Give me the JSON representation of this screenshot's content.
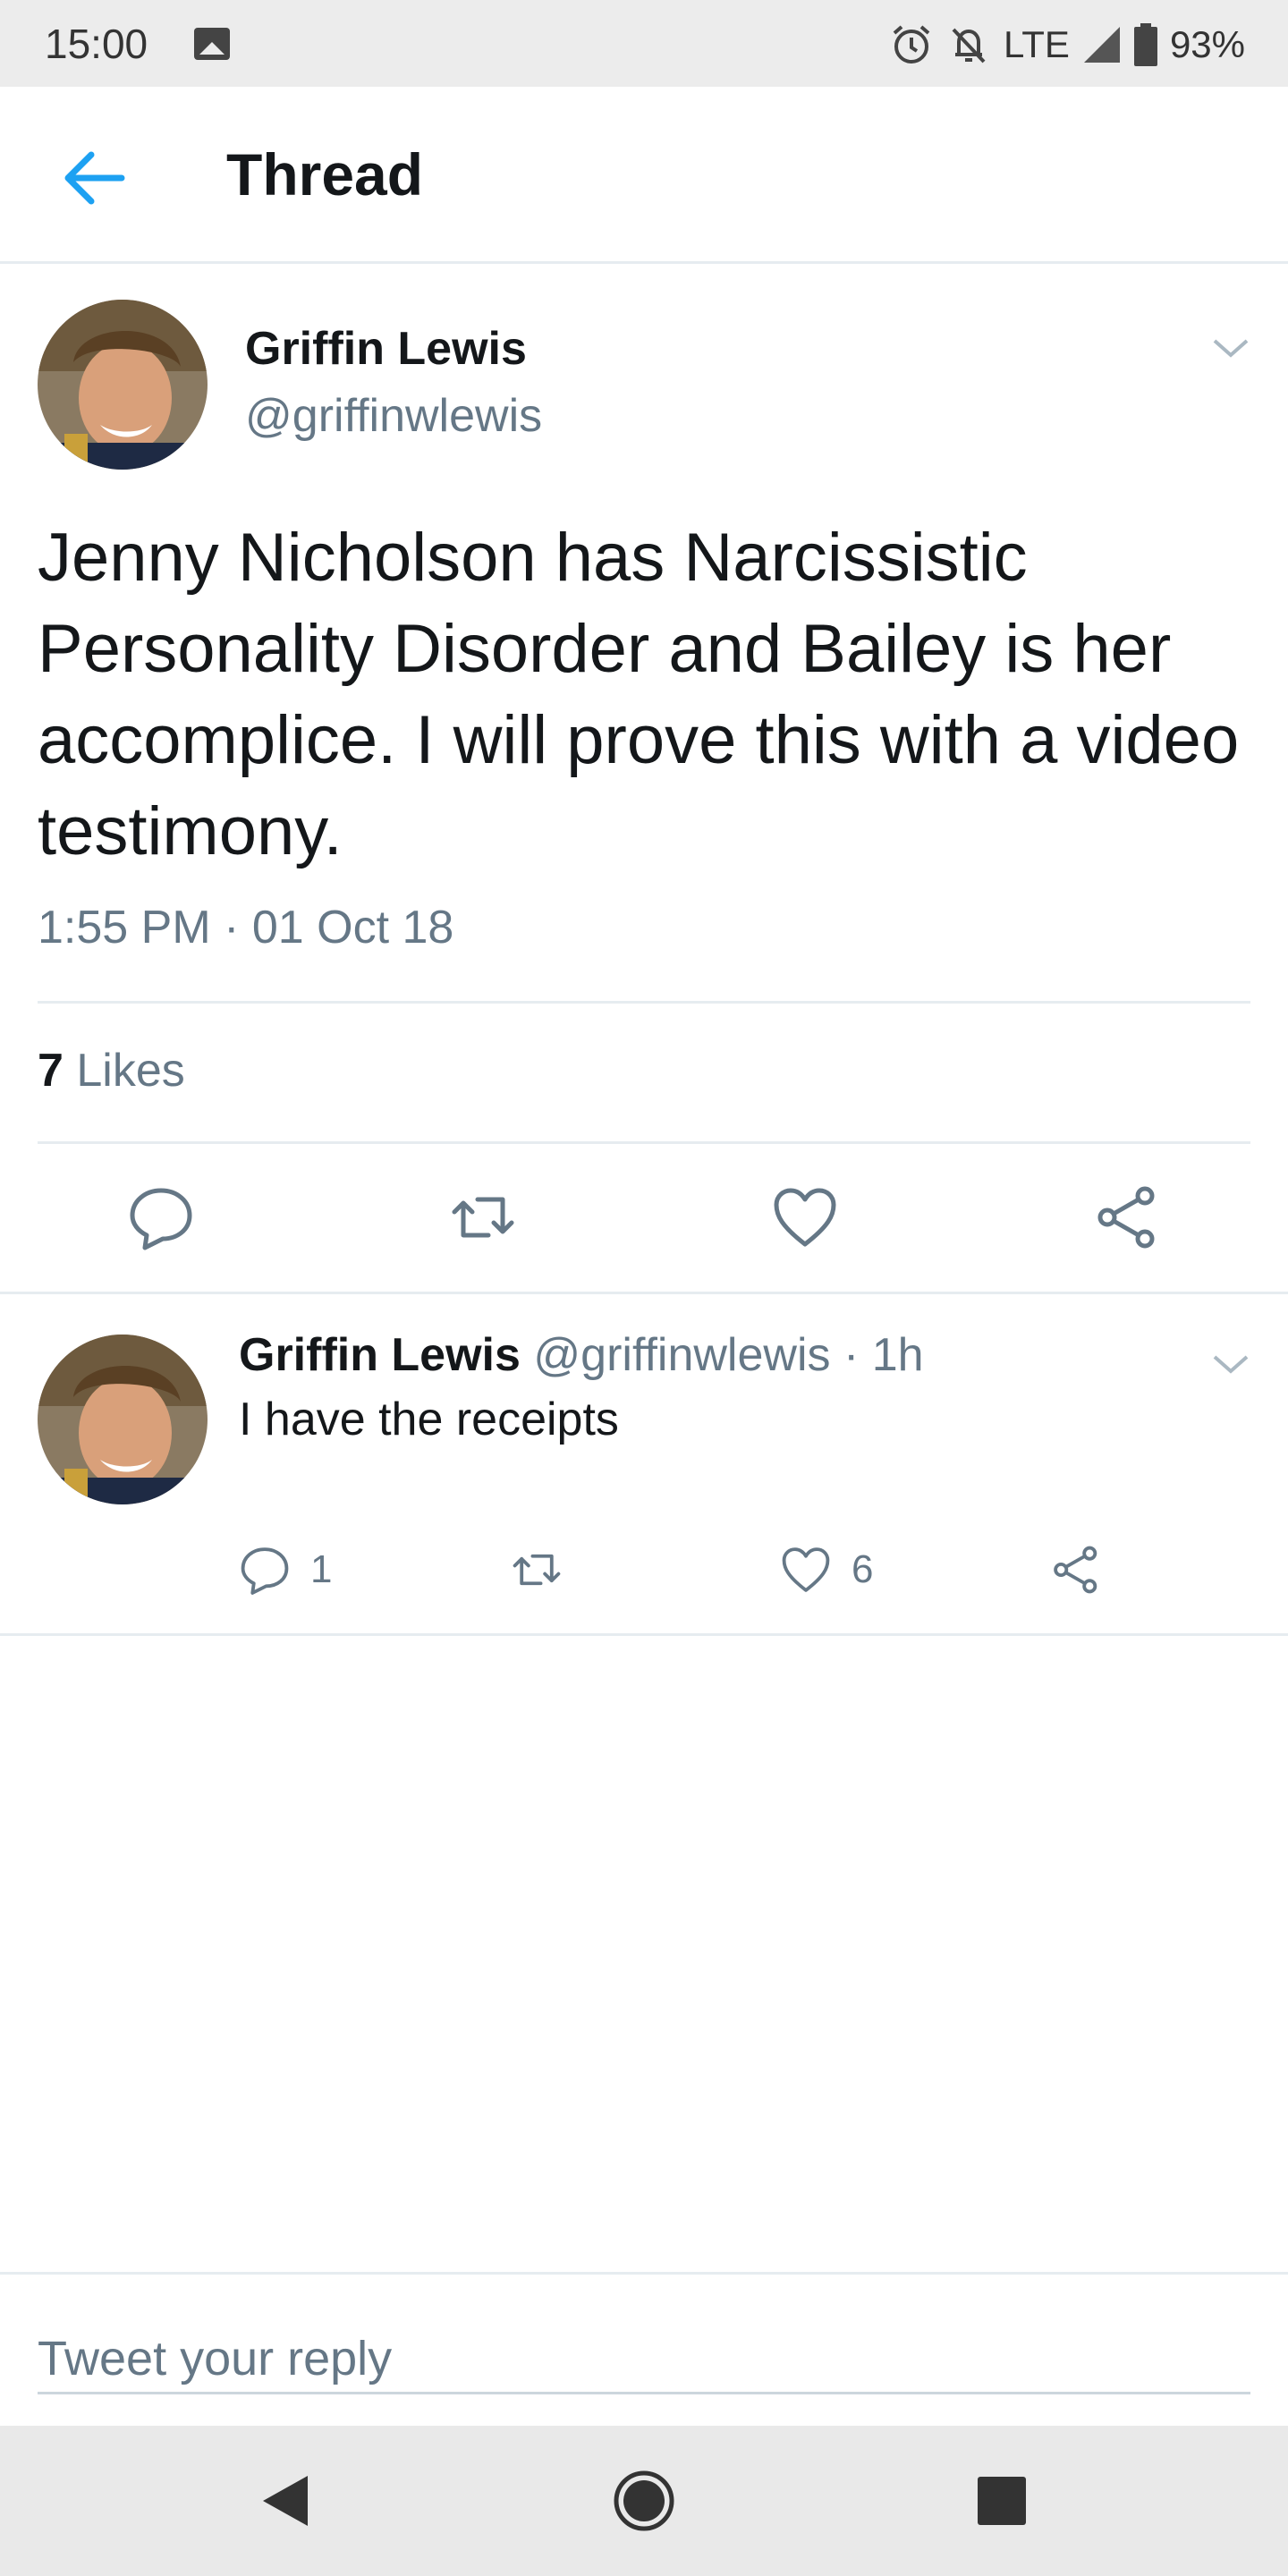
{
  "status_bar": {
    "time": "15:00",
    "network": "LTE",
    "battery": "93%",
    "icons": [
      "image-icon",
      "alarm-icon",
      "notifications-off-icon",
      "signal-icon",
      "battery-icon"
    ]
  },
  "header": {
    "title": "Thread",
    "back_icon": "arrow-left-icon",
    "accent_color": "#1da1f2"
  },
  "main_tweet": {
    "name": "Griffin Lewis",
    "handle": "@griffinwlewis",
    "text": "Jenny Nicholson has Narcissistic Personality Disorder and Bailey is her accomplice. I will prove this with a video testimony.",
    "timestamp": "1:55 PM · 01 Oct 18",
    "likes_count": "7",
    "likes_label": "Likes",
    "actions": [
      "reply-icon",
      "retweet-icon",
      "like-icon",
      "share-icon"
    ]
  },
  "reply_tweet": {
    "name": "Griffin Lewis",
    "meta": "@griffinwlewis · 1h",
    "text": "I have the receipts",
    "reply_count": "1",
    "like_count": "6"
  },
  "composer": {
    "placeholder": "Tweet your reply"
  },
  "colors": {
    "text_primary": "#14171a",
    "text_secondary": "#657786",
    "divider": "#e6ecf0"
  }
}
